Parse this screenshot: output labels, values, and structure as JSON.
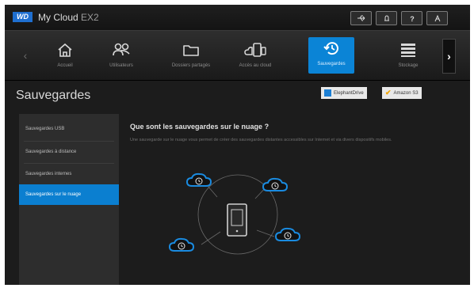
{
  "header": {
    "logo": "WD",
    "device_name": "My Cloud",
    "device_model": "EX2",
    "icons": [
      "usb-icon",
      "bell-icon",
      "help-icon",
      "user-icon"
    ]
  },
  "nav": {
    "items": [
      {
        "label": "Accueil",
        "icon": "home-icon"
      },
      {
        "label": "Utilisateurs",
        "icon": "users-icon"
      },
      {
        "label": "Dossiers partagés",
        "icon": "folder-icon"
      },
      {
        "label": "Accès au cloud",
        "icon": "cloud-devices-icon"
      },
      {
        "label": "Sauvegardes",
        "icon": "backup-icon",
        "active": true
      },
      {
        "label": "Stockage",
        "icon": "storage-icon"
      }
    ]
  },
  "page": {
    "title": "Sauvegardes",
    "services": [
      {
        "label": "ElephantDrive"
      },
      {
        "label": "Amazon S3"
      }
    ]
  },
  "sidebar": {
    "items": [
      {
        "label": "Sauvegardes USB"
      },
      {
        "label": "Sauvegardes à distance"
      },
      {
        "label": "Sauvegardes internes"
      },
      {
        "label": "Sauvegardes sur le nuage",
        "active": true
      }
    ]
  },
  "main": {
    "heading": "Que sont les sauvegardes sur le nuage ?",
    "description": "Une sauvegarde sur le nuage vous permet de créer des sauvegardes distantes accessibles sur Internet et via divers dispositifs mobiles."
  },
  "colors": {
    "accent": "#0b84d6",
    "background": "#1c1c1c",
    "sidebar": "#2d2d2d"
  }
}
